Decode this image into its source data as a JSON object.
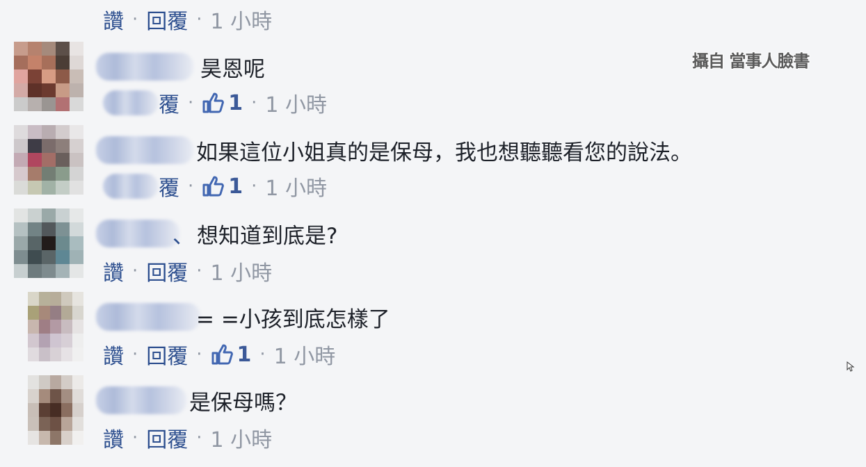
{
  "watermark": "攝自 當事人臉書",
  "actions": {
    "like": "讚",
    "reply": "回覆",
    "sep": "·",
    "time": "1 小時",
    "like_count": "1",
    "partial_reply": "覆",
    "partial_reply2": "覆"
  },
  "comments": [
    {
      "text": "昊恩呢"
    },
    {
      "text": "如果這位小姐真的是保母，我也想聽聽看您的說法。"
    },
    {
      "text": "想知道到底是?",
      "prefix": "、"
    },
    {
      "text": "= =小孩到底怎樣了"
    },
    {
      "text": "是保母嗎？"
    }
  ],
  "colors": {
    "link": "#2d4f8f",
    "muted": "#9097a3",
    "text": "#1d2129",
    "like_blue": "#3b5998"
  },
  "icons": [
    "thumbs-up-icon",
    "cursor-icon"
  ]
}
